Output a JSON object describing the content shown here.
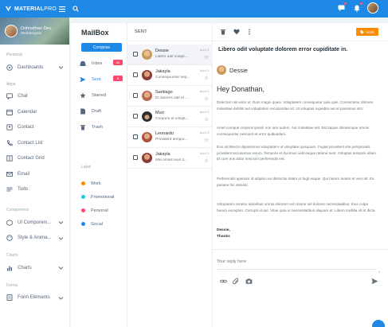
{
  "app": {
    "brand_bold": "MATERIAL",
    "brand_light": "PRO",
    "colors": {
      "primary": "#1e88e5",
      "danger": "#fc4b6c",
      "warning": "#fb8c00",
      "background": "#eef5f9"
    }
  },
  "profile": {
    "name": "Dohnathan Deo",
    "role": "Webdesigner"
  },
  "sidebar": {
    "sections": [
      {
        "title": "Personal",
        "items": [
          {
            "label": "Dashboards",
            "icon": "dashboard-icon",
            "has_chevron": true
          }
        ]
      },
      {
        "title": "Apps",
        "items": [
          {
            "label": "Chat",
            "icon": "chat-icon"
          },
          {
            "label": "Calendar",
            "icon": "calendar-icon"
          },
          {
            "label": "Contact",
            "icon": "contact-icon"
          },
          {
            "label": "Contact List",
            "icon": "phone-icon"
          },
          {
            "label": "Contact Grid",
            "icon": "grid-icon"
          },
          {
            "label": "Email",
            "icon": "mail-icon"
          },
          {
            "label": "Todo",
            "icon": "list-icon"
          }
        ]
      },
      {
        "title": "Components",
        "items": [
          {
            "label": "UI Componen...",
            "icon": "cube-icon",
            "has_chevron": true
          },
          {
            "label": "Style & Anima...",
            "icon": "palette-icon",
            "has_chevron": true
          }
        ]
      },
      {
        "title": "Charts",
        "items": [
          {
            "label": "Charts",
            "icon": "chart-icon",
            "has_chevron": true
          }
        ]
      },
      {
        "title": "Forms",
        "items": [
          {
            "label": "Form Elements",
            "icon": "form-icon",
            "has_chevron": true
          }
        ]
      }
    ]
  },
  "mailbox": {
    "title": "MailBox",
    "compose_label": "Compose",
    "folders": [
      {
        "label": "Inbox",
        "icon": "inbox-icon",
        "badge": "20",
        "active": false
      },
      {
        "label": "Sent",
        "icon": "send-icon",
        "badge": "5",
        "active": true
      },
      {
        "label": "Starred",
        "icon": "star-icon",
        "badge": "",
        "active": false
      },
      {
        "label": "Draft",
        "icon": "draft-icon",
        "badge": "",
        "active": false
      },
      {
        "label": "Trash",
        "icon": "trash-icon",
        "badge": "",
        "active": false
      }
    ],
    "labels_heading": "Label",
    "labels": [
      {
        "label": "Work",
        "color": "#fb8c00"
      },
      {
        "label": "Promotional",
        "color": "#26c6da"
      },
      {
        "label": "Personal",
        "color": "#fc4b6c"
      },
      {
        "label": "Social",
        "color": "#1e88e5"
      }
    ]
  },
  "message_list": {
    "heading": "SENT",
    "messages": [
      {
        "name": "Dessie",
        "preview": "Libero odit volupt...",
        "date": "April 3",
        "selected": true,
        "avatar_color": "#c79a5b"
      },
      {
        "name": "Jakayla",
        "preview": "Consequuntur neq...",
        "date": "April 3",
        "selected": false,
        "avatar_color": "#8d3a3a"
      },
      {
        "name": "Santiago",
        "preview": "Et dolores odit et ...",
        "date": "April 3",
        "selected": false,
        "avatar_color": "#b56b52"
      },
      {
        "name": "Muri",
        "preview": "Corporis et volupt...",
        "date": "April 3",
        "selected": false,
        "avatar_color": "#2e2e2e"
      },
      {
        "name": "Leonardo",
        "preview": "Provident tempor...",
        "date": "April 3",
        "selected": false,
        "avatar_color": "#a8553c"
      },
      {
        "name": "Jakayla",
        "preview": "Iste omnis eius d...",
        "date": "April 3",
        "selected": false,
        "avatar_color": "#8d3a3a"
      }
    ]
  },
  "reader": {
    "tag": "Work",
    "subject": "Libero odit voluptate dolorem error cupiditate in.",
    "sender": "Dessie",
    "greeting": "Hey Donathan,",
    "paragraphs": [
      "Delectus nisi enim ut. Rum magni quasi. Voluptatem consequatur quia quis. Consectetur dolores molestiae debitis aut voluptatem recusandae sit. Ut voluptas expedita aut et possimus sint.",
      "Amet cumque corporis ipsam non iure autem. Aut molestiae est. Est itaque doloremque omnis consequuntur nesciunt et error quibusdam.",
      "Eos architecto dignissimos voluptatem ut voluptate quisquam. Fugiat provident iste perspiciatis provident accusamus rerum. Tempore et ducimus velit eaque ratione sunt. Voluptas tempore ullam. Et cum eos dolor nesciunt perferendis est.",
      "Perferendis aperiam id adipisci eo distinctio totam ut fugit eaque. Qui harum autem et vero sit. Ex pariatur hic deleniti.",
      "Voluptatem tenetur doloribus omnis dolorem vel ratione vel dolores necessitatibus. Eius culpa harum excepturi. Corrupti ut aut. Vitae quia ut necessitatibus aliquam et. Libero mollitia sit et dicta."
    ],
    "signoff": "Dessie,",
    "signoff2": "Thanks",
    "reply_placeholder": "Your reply here",
    "char_count": "0"
  }
}
